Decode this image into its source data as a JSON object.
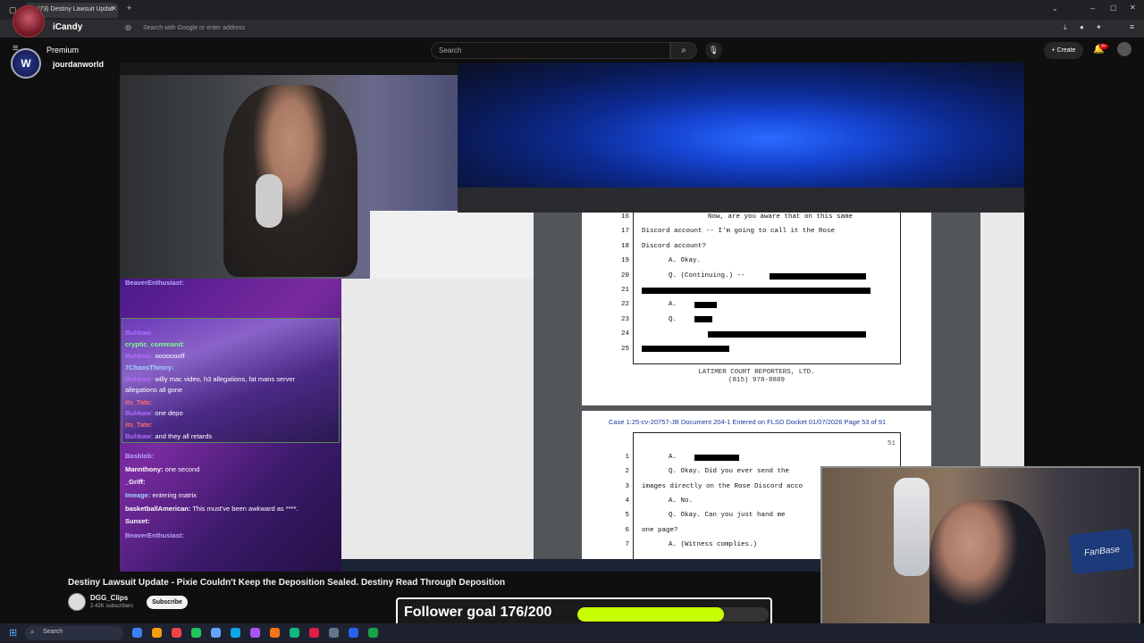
{
  "browser": {
    "tab_title": "(73) Destiny Lawsuit Updat",
    "address_placeholder": "Search with Google or enter address"
  },
  "youtube": {
    "search_placeholder": "Search",
    "create_label": "Create",
    "notification_count": "9+"
  },
  "overlay": {
    "channel_name": "iCandy",
    "premium_label": "Premium",
    "handle": "jourdanworld",
    "logo_letter": "W"
  },
  "chat": {
    "lines": [
      {
        "user": "BeaverEnthusiast:",
        "text": "",
        "color": "#b8a6ff"
      },
      {
        "user": "Buhkaw:",
        "text": "",
        "color": "#b26cff"
      },
      {
        "user": "cryptic_command:",
        "text": "",
        "color": "#7dff8a"
      },
      {
        "user": "Buhkaw:",
        "text": "oooooooff",
        "color": "#b26cff"
      },
      {
        "user": "7ChaosTheory:",
        "text": "",
        "color": "#9fd6ff"
      },
      {
        "user": "Buhkaw:",
        "text": "willy mac video, h3 allegations, fat mans server",
        "color": "#b26cff"
      },
      {
        "user": "",
        "text": "allegations all gone",
        "color": "#ffffff"
      },
      {
        "user": "its_Tate:",
        "text": "",
        "color": "#ff6a6a"
      },
      {
        "user": "Buhkaw:",
        "text": "one depo",
        "color": "#b26cff"
      },
      {
        "user": "its_Tate:",
        "text": "",
        "color": "#ff6a6a"
      },
      {
        "user": "Buhkaw:",
        "text": "and they all retards",
        "color": "#b26cff"
      },
      {
        "user": "Basblob:",
        "text": "",
        "color": "#b8a6ff"
      },
      {
        "user": "Mannthony:",
        "text": "one second",
        "color": "#ffffff"
      },
      {
        "user": "_Griff:",
        "text": "",
        "color": "#ffffff"
      },
      {
        "user": "Imeage:",
        "text": "entering matrix",
        "color": "#9fd6ff"
      },
      {
        "user": "basketballAmerican:",
        "text": "This must've been awkward as ****.",
        "color": "#ffffff"
      },
      {
        "user": "Sunset:",
        "text": "",
        "color": "#ffffff"
      },
      {
        "user": "BeaverEnthusiast:",
        "text": "",
        "color": "#b8a6ff"
      }
    ]
  },
  "document": {
    "page1_lines": [
      {
        "num": "16",
        "text": "Now, are you aware that on this same"
      },
      {
        "num": "17",
        "text": "Discord account -- I'm going to call it the Rose"
      },
      {
        "num": "18",
        "text": "Discord account?"
      },
      {
        "num": "19",
        "text": "A.     Okay."
      },
      {
        "num": "20",
        "text": "Q.     (Continuing.) --"
      },
      {
        "num": "21",
        "text": ""
      },
      {
        "num": "22",
        "text": "A."
      },
      {
        "num": "23",
        "text": "Q."
      },
      {
        "num": "24",
        "text": ""
      },
      {
        "num": "25",
        "text": ""
      }
    ],
    "reporter_name": "LATIMER COURT REPORTERS, LTD.",
    "reporter_phone": "(815) 978-8889",
    "case_header": "Case 1:25-cv-20757-JB   Document 204-1   Entered on FLSD Docket 01/07/2026   Page 53 of 91",
    "page_number": "51",
    "page2_lines": [
      {
        "num": "1",
        "text": "A."
      },
      {
        "num": "2",
        "text": "Q.     Okay.  Did you ever send the"
      },
      {
        "num": "3",
        "text": "images directly on the Rose Discord acco"
      },
      {
        "num": "4",
        "text": "A.     No."
      },
      {
        "num": "5",
        "text": "Q.     Okay.  Can you just hand me"
      },
      {
        "num": "6",
        "text": "one page?"
      },
      {
        "num": "7",
        "text": "A.     (Witness complies.)"
      }
    ]
  },
  "video": {
    "title": "Destiny Lawsuit Update - Pixie Couldn't Keep the Deposition Sealed. Destiny Read Through Deposition",
    "channel": "DGG_Clips",
    "subscribers": "2.42K subscribers",
    "subscribe_label": "Subscribe"
  },
  "follower_goal": {
    "label": "Follower goal 176/200",
    "current": 176,
    "target": 200,
    "fill_color": "#c8ff00"
  },
  "webcam2": {
    "sign_text": "FanBase"
  },
  "taskbar": {
    "search_label": "Search"
  }
}
